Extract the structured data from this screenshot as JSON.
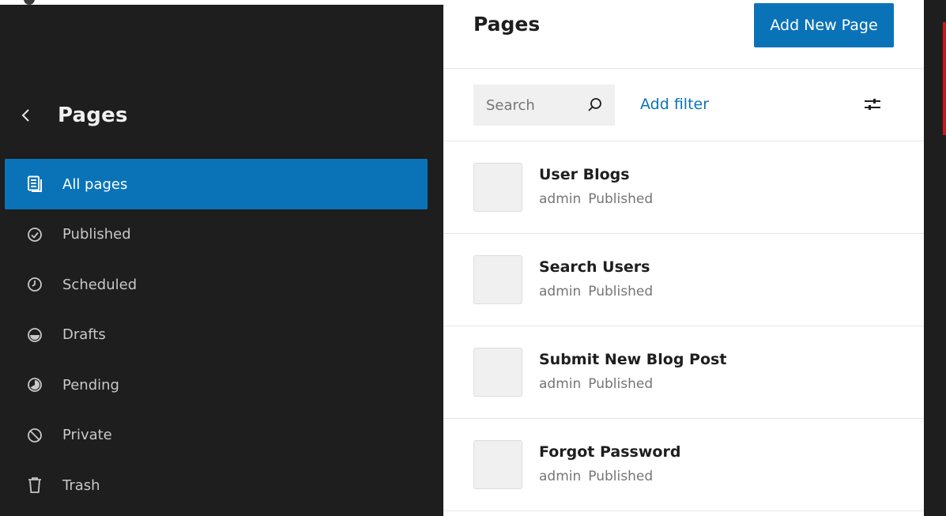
{
  "sidebar": {
    "back_icon": "chevron-left-icon",
    "title": "Pages",
    "items": [
      {
        "label": "All pages",
        "icon": "pages-icon",
        "active": true
      },
      {
        "label": "Published",
        "icon": "published-icon",
        "active": false
      },
      {
        "label": "Scheduled",
        "icon": "scheduled-icon",
        "active": false
      },
      {
        "label": "Drafts",
        "icon": "drafts-icon",
        "active": false
      },
      {
        "label": "Pending",
        "icon": "pending-icon",
        "active": false
      },
      {
        "label": "Private",
        "icon": "private-icon",
        "active": false
      },
      {
        "label": "Trash",
        "icon": "trash-icon",
        "active": false
      }
    ]
  },
  "header": {
    "title": "Pages",
    "add_button": "Add New Page"
  },
  "toolbar": {
    "search_placeholder": "Search",
    "search_value": "",
    "add_filter": "Add filter",
    "settings_icon": "sliders-icon"
  },
  "pages": [
    {
      "title": "User Blogs",
      "author": "admin",
      "status": "Published"
    },
    {
      "title": "Search Users",
      "author": "admin",
      "status": "Published"
    },
    {
      "title": "Submit New Blog Post",
      "author": "admin",
      "status": "Published"
    },
    {
      "title": "Forgot Password",
      "author": "admin",
      "status": "Published"
    }
  ],
  "colors": {
    "accent": "#0a73b8",
    "sidebar_bg": "#1e1e1e",
    "text_muted": "#757575"
  }
}
